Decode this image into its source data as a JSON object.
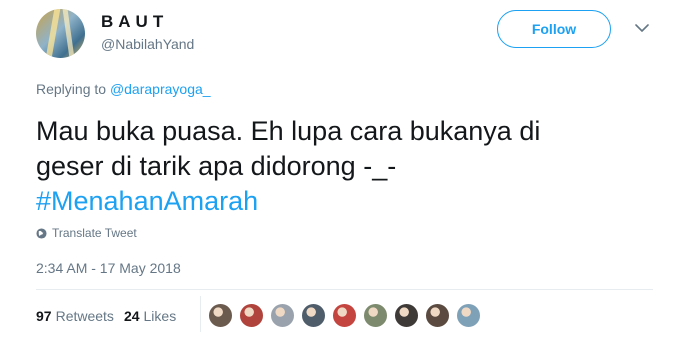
{
  "author": {
    "display_name": "BAUT",
    "handle": "@NabilahYand"
  },
  "follow_button": {
    "label": "Follow"
  },
  "replying": {
    "prefix": "Replying to ",
    "mention": "@daraprayoga_"
  },
  "tweet": {
    "line1": "Mau buka puasa. Eh lupa cara bukanya di",
    "line2": "geser di tarik apa didorong -_-",
    "hashtag": "#MenahanAmarah"
  },
  "translate": {
    "label": "Translate Tweet"
  },
  "timestamp": "2:34 AM - 17 May 2018",
  "stats": {
    "retweets_count": "97",
    "retweets_label": "Retweets",
    "likes_count": "24",
    "likes_label": "Likes"
  },
  "likers": [
    {
      "color": "#6b5a4e"
    },
    {
      "color": "#b0433b"
    },
    {
      "color": "#9aa3ad"
    },
    {
      "color": "#4f5d6b"
    },
    {
      "color": "#c4453f"
    },
    {
      "color": "#7d8a6e"
    },
    {
      "color": "#3e3a38"
    },
    {
      "color": "#5a4a40"
    },
    {
      "color": "#7fa1b8"
    }
  ],
  "colors": {
    "accent": "#1da1f2",
    "text": "#14171a",
    "muted": "#657786",
    "divider": "#e6ecf0"
  },
  "icons": [
    "globe-icon",
    "chevron-down-icon"
  ]
}
